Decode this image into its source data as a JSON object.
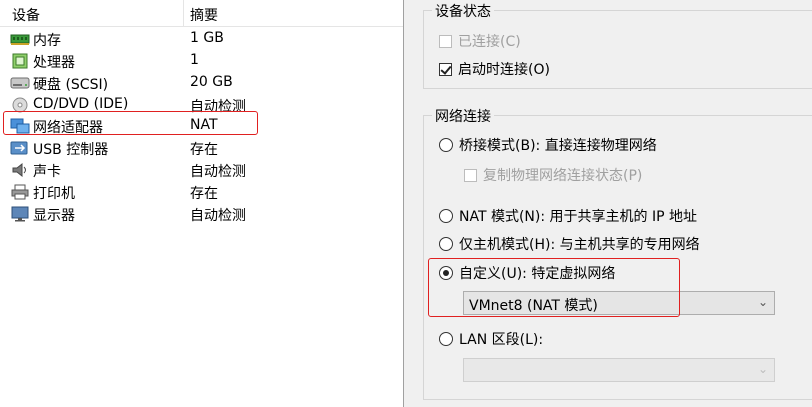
{
  "device_list": {
    "headers": {
      "device": "设备",
      "summary": "摘要"
    },
    "rows": [
      {
        "name": "内存",
        "summary": "1 GB",
        "icon": "memory-icon"
      },
      {
        "name": "处理器",
        "summary": "1",
        "icon": "processor-icon"
      },
      {
        "name": "硬盘 (SCSI)",
        "summary": "20 GB",
        "icon": "hard-disk-icon"
      },
      {
        "name": "CD/DVD (IDE)",
        "summary": "自动检测",
        "icon": "cd-dvd-icon"
      },
      {
        "name": "网络适配器",
        "summary": "NAT",
        "icon": "network-adapter-icon",
        "selected": true
      },
      {
        "name": "USB 控制器",
        "summary": "存在",
        "icon": "usb-icon"
      },
      {
        "name": "声卡",
        "summary": "自动检测",
        "icon": "sound-card-icon"
      },
      {
        "name": "打印机",
        "summary": "存在",
        "icon": "printer-icon"
      },
      {
        "name": "显示器",
        "summary": "自动检测",
        "icon": "display-icon"
      }
    ]
  },
  "device_status": {
    "title": "设备状态",
    "connected": {
      "label": "已连接(C)",
      "checked": false,
      "enabled": false
    },
    "connect_at_power_on": {
      "label": "启动时连接(O)",
      "checked": true,
      "enabled": true
    }
  },
  "network_connection": {
    "title": "网络连接",
    "bridged": {
      "label": "桥接模式(B): 直接连接物理网络",
      "selected": false
    },
    "replicate_state": {
      "label": "复制物理网络连接状态(P)",
      "checked": false,
      "enabled": false
    },
    "nat": {
      "label": "NAT 模式(N): 用于共享主机的 IP 地址",
      "selected": false
    },
    "host_only": {
      "label": "仅主机模式(H): 与主机共享的专用网络",
      "selected": false
    },
    "custom": {
      "label": "自定义(U): 特定虚拟网络",
      "selected": true
    },
    "custom_network_value": "VMnet8 (NAT 模式)",
    "lan_segment": {
      "label": "LAN 区段(L):",
      "selected": false
    },
    "lan_segment_value": ""
  },
  "colors": {
    "highlight": "#e02020",
    "panel_bg": "#f0f0f0"
  }
}
